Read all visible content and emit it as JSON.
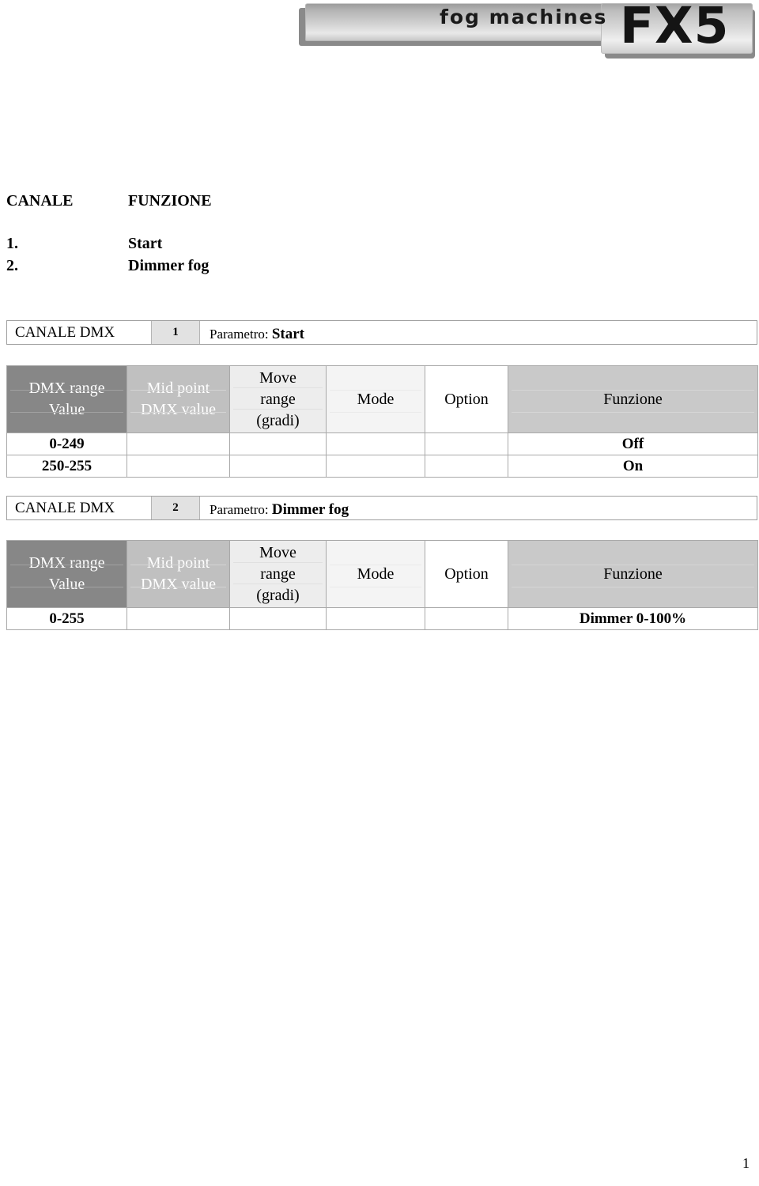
{
  "header": {
    "brand_primary": "fog machines",
    "brand_model": "FX5"
  },
  "channel_list": {
    "col_channel_header": "CANALE",
    "col_function_header": "FUNZIONE",
    "rows": [
      {
        "channel": "1.",
        "function": "Start"
      },
      {
        "channel": "2.",
        "function": "Dimmer fog"
      }
    ]
  },
  "tables": [
    {
      "channel_label": "CANALE DMX",
      "channel_number": "1",
      "param_prefix": "Parametro:",
      "param_name": "Start",
      "columns": [
        {
          "label_line1": "DMX range",
          "label_line2": "Value",
          "label_line3": ""
        },
        {
          "label_line1": "Mid point",
          "label_line2": "DMX value",
          "label_line3": ""
        },
        {
          "label_line1": "Move",
          "label_line2": "range",
          "label_line3": "(gradi)"
        },
        {
          "label_line1": "Mode",
          "label_line2": "",
          "label_line3": ""
        },
        {
          "label_line1": "Option",
          "label_line2": "",
          "label_line3": ""
        },
        {
          "label_line1": "Funzione",
          "label_line2": "",
          "label_line3": ""
        }
      ],
      "rows": [
        {
          "dmx_range": "0-249",
          "mid_point": "",
          "move_range": "",
          "mode": "",
          "option": "",
          "funzione": "Off"
        },
        {
          "dmx_range": "250-255",
          "mid_point": "",
          "move_range": "",
          "mode": "",
          "option": "",
          "funzione": "On"
        }
      ]
    },
    {
      "channel_label": "CANALE DMX",
      "channel_number": "2",
      "param_prefix": "Parametro:",
      "param_name": "Dimmer fog",
      "columns": [
        {
          "label_line1": "DMX range",
          "label_line2": "Value",
          "label_line3": ""
        },
        {
          "label_line1": "Mid point",
          "label_line2": "DMX value",
          "label_line3": ""
        },
        {
          "label_line1": "Move",
          "label_line2": "range",
          "label_line3": "(gradi)"
        },
        {
          "label_line1": "Mode",
          "label_line2": "",
          "label_line3": ""
        },
        {
          "label_line1": "Option",
          "label_line2": "",
          "label_line3": ""
        },
        {
          "label_line1": "Funzione",
          "label_line2": "",
          "label_line3": ""
        }
      ],
      "rows": [
        {
          "dmx_range": "0-255",
          "mid_point": "",
          "move_range": "",
          "mode": "",
          "option": "",
          "funzione": "Dimmer 0-100%"
        }
      ]
    }
  ],
  "footer": {
    "page_number": "1"
  },
  "colors": {
    "dmx_range_header": "#878787",
    "mid_point_header": "#c0c0c0",
    "move_range_header": "#ededed",
    "mode_header": "#f4f4f4",
    "option_header": "#ffffff",
    "funzione_header": "#c9c9c9",
    "table_border": "#a9a9a9",
    "banner_shadow": "#8a8a8a"
  }
}
